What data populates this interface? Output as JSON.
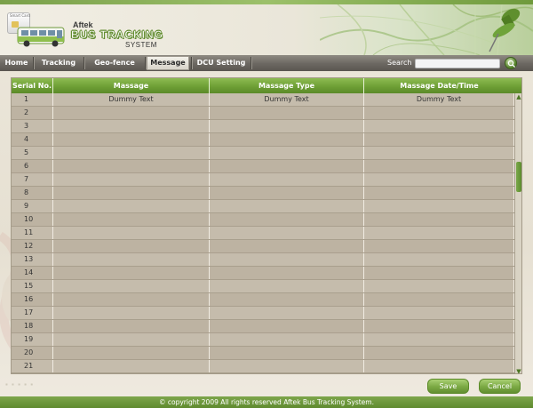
{
  "header": {
    "card_label": "Smart Card",
    "brand_company": "Aftek",
    "brand_title": "BUS TRACKING",
    "brand_subtitle": "SYSTEM"
  },
  "nav": {
    "items": [
      {
        "label": "Home"
      },
      {
        "label": "Tracking"
      },
      {
        "label": "Geo-fence"
      },
      {
        "label": "Message"
      },
      {
        "label": "DCU Setting"
      }
    ],
    "active": "Message",
    "search_label": "Search",
    "search_value": ""
  },
  "table": {
    "columns": [
      "Serial No.",
      "Massage",
      "Massage Type",
      "Massage Date/Time"
    ],
    "rows": [
      {
        "serial": "1",
        "message": "Dummy Text",
        "type": "Dummy Text",
        "datetime": "Dummy Text"
      },
      {
        "serial": "2",
        "message": "",
        "type": "",
        "datetime": ""
      },
      {
        "serial": "3",
        "message": "",
        "type": "",
        "datetime": ""
      },
      {
        "serial": "4",
        "message": "",
        "type": "",
        "datetime": ""
      },
      {
        "serial": "5",
        "message": "",
        "type": "",
        "datetime": ""
      },
      {
        "serial": "6",
        "message": "",
        "type": "",
        "datetime": ""
      },
      {
        "serial": "7",
        "message": "",
        "type": "",
        "datetime": ""
      },
      {
        "serial": "8",
        "message": "",
        "type": "",
        "datetime": ""
      },
      {
        "serial": "9",
        "message": "",
        "type": "",
        "datetime": ""
      },
      {
        "serial": "10",
        "message": "",
        "type": "",
        "datetime": ""
      },
      {
        "serial": "11",
        "message": "",
        "type": "",
        "datetime": ""
      },
      {
        "serial": "12",
        "message": "",
        "type": "",
        "datetime": ""
      },
      {
        "serial": "13",
        "message": "",
        "type": "",
        "datetime": ""
      },
      {
        "serial": "14",
        "message": "",
        "type": "",
        "datetime": ""
      },
      {
        "serial": "15",
        "message": "",
        "type": "",
        "datetime": ""
      },
      {
        "serial": "16",
        "message": "",
        "type": "",
        "datetime": ""
      },
      {
        "serial": "17",
        "message": "",
        "type": "",
        "datetime": ""
      },
      {
        "serial": "18",
        "message": "",
        "type": "",
        "datetime": ""
      },
      {
        "serial": "19",
        "message": "",
        "type": "",
        "datetime": ""
      },
      {
        "serial": "20",
        "message": "",
        "type": "",
        "datetime": ""
      },
      {
        "serial": "21",
        "message": "",
        "type": "",
        "datetime": ""
      }
    ]
  },
  "buttons": {
    "save": "Save",
    "cancel": "Cancel"
  },
  "footer": {
    "copyright": "© copyright 2009 All rights reserved Aftek Bus Tracking System."
  },
  "icons": {
    "search_button": "search-icon",
    "pushpin": "pushpin-icon",
    "bus": "bus-icon",
    "smart_card": "smart-card-icon",
    "scroll_up": "scroll-up-icon",
    "scroll_down": "scroll-down-icon"
  },
  "colors": {
    "accent_green": "#6e9f35",
    "nav_gray": "#6b6761",
    "table_bg": "#c5bcac",
    "footer_green": "#6f9a3c"
  }
}
